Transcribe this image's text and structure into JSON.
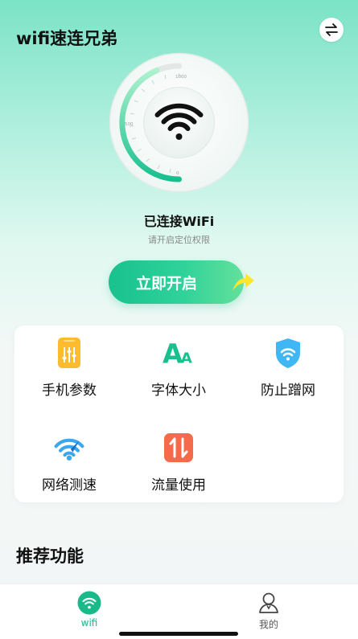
{
  "header": {
    "app_title": "wifi速连兄弟"
  },
  "gauge": {
    "ticks": [
      "1000",
      "500",
      "0"
    ]
  },
  "status": {
    "title": "已连接WiFi",
    "subtitle": "请开启定位权限"
  },
  "start_button": {
    "label": "立即开启"
  },
  "tools": [
    {
      "label": "手机参数",
      "icon": "phone-settings-icon"
    },
    {
      "label": "字体大小",
      "icon": "font-size-icon"
    },
    {
      "label": "防止蹭网",
      "icon": "wifi-shield-icon"
    },
    {
      "label": "网络测速",
      "icon": "speed-test-icon"
    },
    {
      "label": "流量使用",
      "icon": "traffic-icon"
    }
  ],
  "section": {
    "recommended_title": "推荐功能"
  },
  "tabbar": {
    "tabs": [
      {
        "label": "wifi",
        "icon": "wifi-tab-icon",
        "active": true
      },
      {
        "label": "我的",
        "icon": "profile-icon",
        "active": false
      }
    ]
  },
  "colors": {
    "accent": "#1fc08d",
    "active_tab": "#19b98a",
    "inactive_tab": "#555555"
  }
}
